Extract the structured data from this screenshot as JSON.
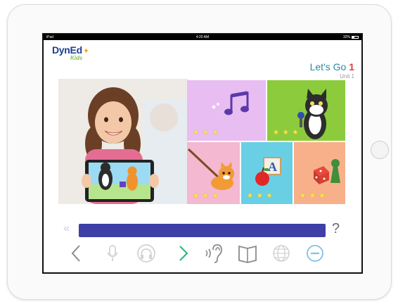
{
  "status": {
    "device": "iPad",
    "time": "4:20 AM",
    "battery": "32%"
  },
  "app": {
    "logo": "DynEd",
    "logo_sub": "Kids"
  },
  "lesson": {
    "title": "Let's Go ",
    "title_number": "1",
    "unit": "Unit 1"
  },
  "tiles": [
    {
      "name": "tile-music",
      "color": "#e8bdf2",
      "stars": "★ ★ ★",
      "icon": "music-notes-icon"
    },
    {
      "name": "tile-cat-microphone",
      "color": "#8ccb3c",
      "stars": "★ ★ ★",
      "icon": "cat-microphone-icon"
    },
    {
      "name": "tile-tiger-reading",
      "color": "#f4b8d0",
      "stars": "★ ★ ★",
      "icon": "tiger-icon"
    },
    {
      "name": "tile-abc-apple",
      "color": "#69cfe5",
      "stars": "★ ★ ★",
      "icon": "apple-block-icon"
    },
    {
      "name": "tile-game",
      "color": "#f8b08b",
      "stars": "★ ★ ★",
      "icon": "dice-icon"
    }
  ],
  "nav": {
    "back_arrows": "«",
    "help": "?"
  },
  "toolbar": [
    {
      "name": "back-arrow-icon",
      "interactable": true
    },
    {
      "name": "microphone-icon",
      "interactable": false
    },
    {
      "name": "headphones-icon",
      "interactable": false
    },
    {
      "name": "next-arrow-icon",
      "interactable": true
    },
    {
      "name": "ear-icon",
      "interactable": true
    },
    {
      "name": "book-icon",
      "interactable": true
    },
    {
      "name": "globe-icon",
      "interactable": false
    },
    {
      "name": "minus-circle-icon",
      "interactable": true
    }
  ],
  "colors": {
    "accent": "#2a8aa5",
    "progress": "#3f3fa8",
    "next": "#2dbb7d",
    "star": "#ffe34a"
  }
}
